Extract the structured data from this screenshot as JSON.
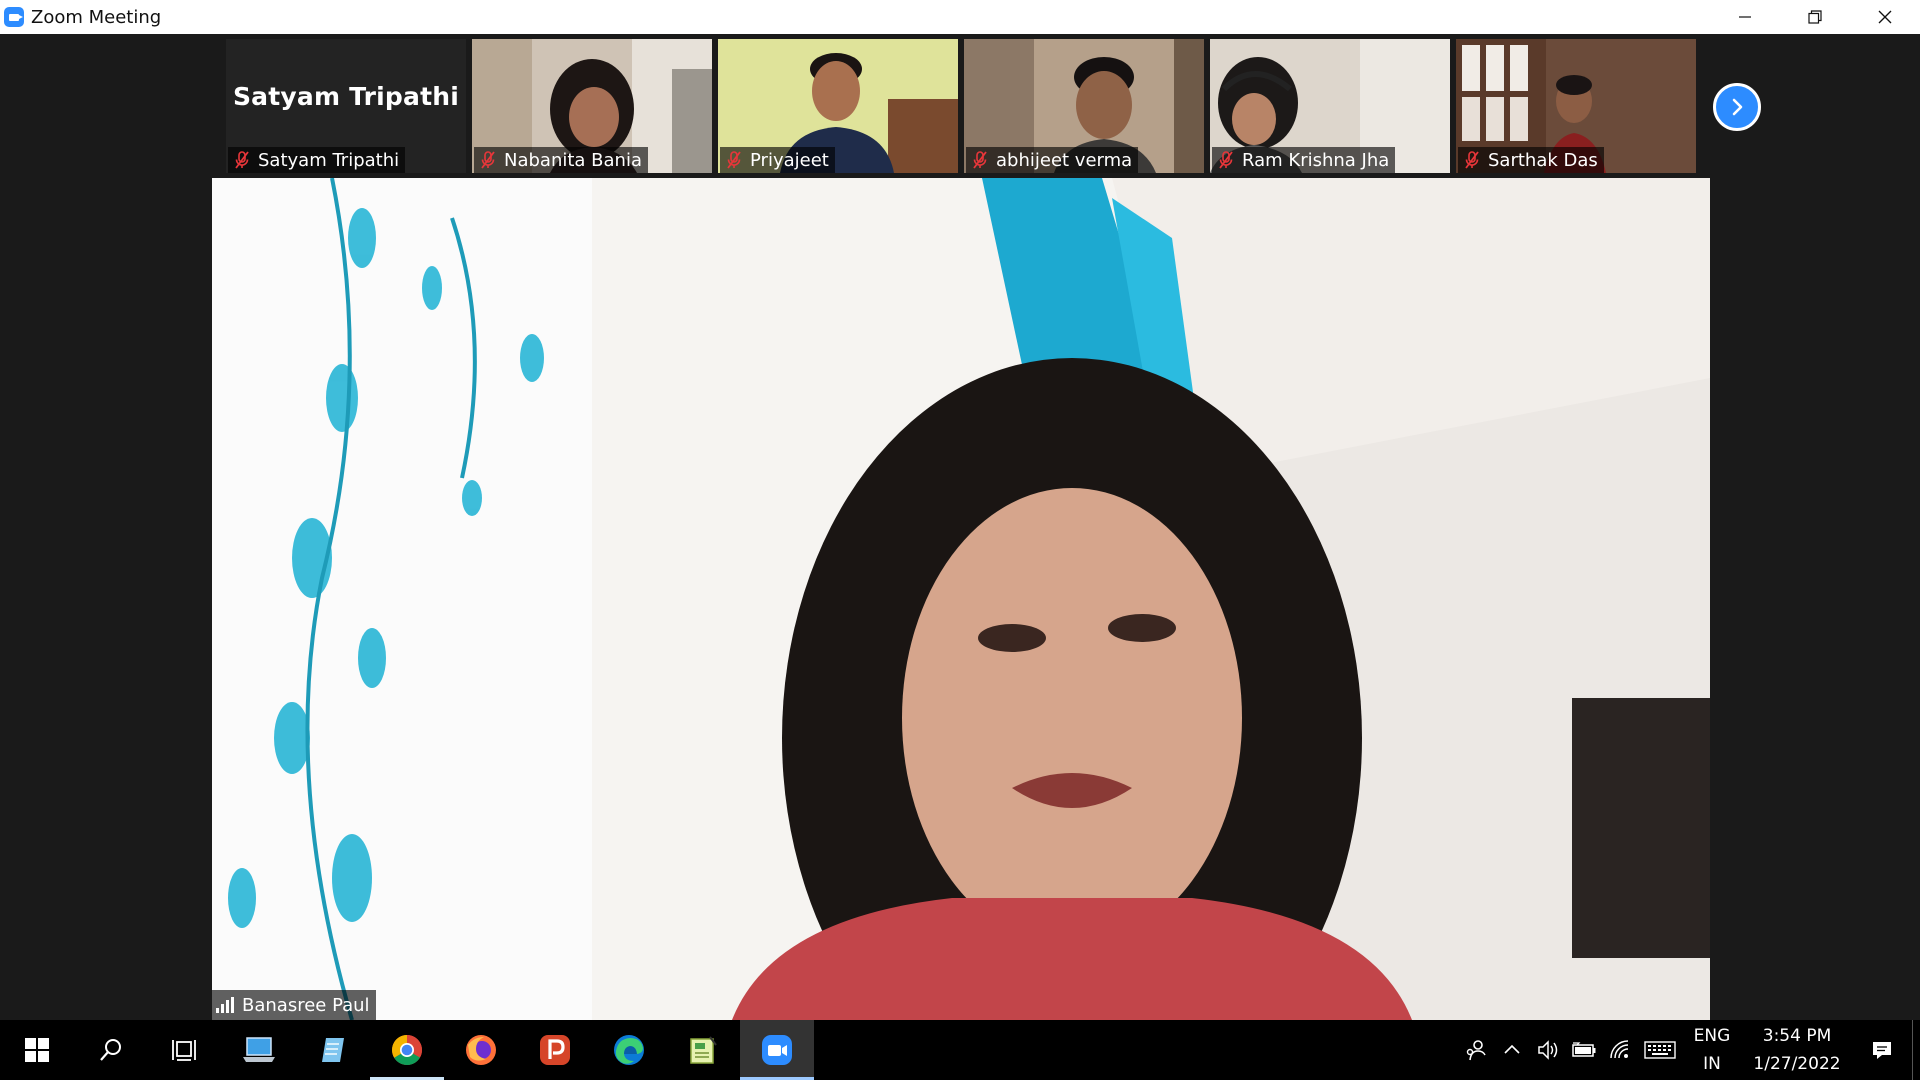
{
  "window": {
    "title": "Zoom Meeting"
  },
  "meeting": {
    "thumbnails": [
      {
        "name": "Satyam Tripathi",
        "display_name": "Satyam Tripathi",
        "video": false,
        "muted": true
      },
      {
        "name": "Nabanita Bania",
        "video": true,
        "muted": true
      },
      {
        "name": "Priyajeet",
        "video": true,
        "muted": true
      },
      {
        "name": "abhijeet verma",
        "video": true,
        "muted": true
      },
      {
        "name": "Ram Krishna Jha",
        "video": true,
        "muted": true
      },
      {
        "name": "Sarthak Das",
        "video": true,
        "muted": true
      }
    ],
    "next_page_icon": "chevron-right-icon",
    "active_speaker": {
      "name": "Banasree Paul",
      "icon": "signal-bars-icon"
    }
  },
  "taskbar": {
    "apps": [
      {
        "name": "start",
        "icon": "windows-logo-icon"
      },
      {
        "name": "search",
        "icon": "search-icon"
      },
      {
        "name": "task-view",
        "icon": "task-view-icon"
      },
      {
        "name": "this-pc",
        "icon": "laptop-icon"
      },
      {
        "name": "notepad",
        "icon": "notepad-icon"
      },
      {
        "name": "chrome",
        "icon": "chrome-icon",
        "running": true
      },
      {
        "name": "firefox",
        "icon": "firefox-icon"
      },
      {
        "name": "wps-presentation",
        "icon": "presentation-p-icon"
      },
      {
        "name": "edge",
        "icon": "edge-icon"
      },
      {
        "name": "notes-app",
        "icon": "notebook-icon"
      },
      {
        "name": "zoom",
        "icon": "zoom-icon",
        "active": true
      }
    ],
    "tray": {
      "lang_top": "ENG",
      "lang_bottom": "IN",
      "time": "3:54 PM",
      "date": "1/27/2022"
    }
  },
  "colors": {
    "zoom_blue": "#2d8cff",
    "mute_red": "#e8363a",
    "background": "#1a1a1a"
  }
}
